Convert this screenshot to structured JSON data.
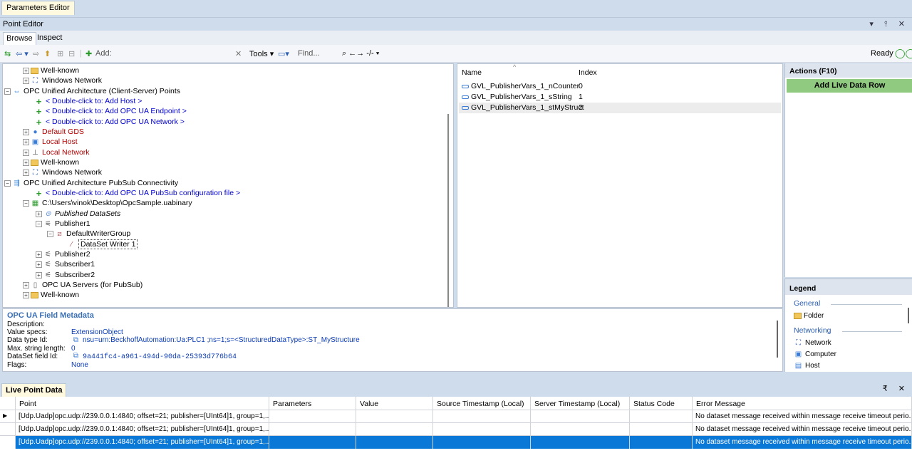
{
  "doc_tab": "Parameters Editor",
  "point_editor": {
    "title": "Point Editor",
    "controls": "▾ ⫯ ✕",
    "tabs": [
      "Browse",
      "Inspect"
    ]
  },
  "toolbar": {
    "add_label": "Add:",
    "tools_label": "Tools",
    "find_placeholder": "Find...",
    "nav_label": "←→ -/-",
    "status": "Ready"
  },
  "tree": [
    {
      "label": "Well-known",
      "style": "normal",
      "icon": "folder-icon"
    },
    {
      "label": "Windows Network",
      "style": "normal",
      "icon": "network-icon"
    },
    {
      "label": "OPC Unified Architecture (Client-Server) Points",
      "style": "normal",
      "icon": "opc-ua-icon"
    },
    {
      "label": "< Double-click to: Add Host >",
      "style": "blue",
      "icon": "add-icon"
    },
    {
      "label": "< Double-click to: Add OPC UA Endpoint >",
      "style": "blue",
      "icon": "add-icon"
    },
    {
      "label": "< Double-click to: Add OPC UA Network >",
      "style": "blue",
      "icon": "add-icon"
    },
    {
      "label": "Default GDS",
      "style": "red",
      "icon": "gds-icon"
    },
    {
      "label": "Local Host",
      "style": "red",
      "icon": "computer-icon"
    },
    {
      "label": "Local Network",
      "style": "red",
      "icon": "local-network-icon"
    },
    {
      "label": "Well-known",
      "style": "normal",
      "icon": "folder-icon"
    },
    {
      "label": "Windows Network",
      "style": "normal",
      "icon": "network-icon"
    },
    {
      "label": "OPC Unified Architecture PubSub Connectivity",
      "style": "normal",
      "icon": "pubsub-icon"
    },
    {
      "label": "< Double-click to: Add OPC UA PubSub configuration file >",
      "style": "blue",
      "icon": "add-icon"
    },
    {
      "label": "C:\\Users\\vinok\\Desktop\\OpcSample.uabinary",
      "style": "normal",
      "icon": "config-file-icon"
    },
    {
      "label": "Published DataSets",
      "style": "italic",
      "icon": "datasets-icon"
    },
    {
      "label": "Publisher1",
      "style": "normal",
      "icon": "publisher-icon"
    },
    {
      "label": "DefaultWriterGroup",
      "style": "normal",
      "icon": "writer-group-icon"
    },
    {
      "label": "DataSet Writer 1",
      "style": "selected",
      "icon": "dataset-writer-icon"
    },
    {
      "label": "Publisher2",
      "style": "normal",
      "icon": "publisher-icon"
    },
    {
      "label": "Subscriber1",
      "style": "normal",
      "icon": "subscriber-icon"
    },
    {
      "label": "Subscriber2",
      "style": "normal",
      "icon": "subscriber-icon"
    },
    {
      "label": "OPC UA Servers (for PubSub)",
      "style": "normal",
      "icon": "folder-icon"
    },
    {
      "label": "Well-known",
      "style": "normal",
      "icon": "folder-icon"
    }
  ],
  "list": {
    "col_name": "Name",
    "col_index": "Index",
    "rows": [
      {
        "name": "GVL_PublisherVars_1_nCounter",
        "index": "0"
      },
      {
        "name": "GVL_PublisherVars_1_sString",
        "index": "1"
      },
      {
        "name": "GVL_PublisherVars_1_stMyStruct",
        "index": "2"
      }
    ]
  },
  "actions": {
    "title": "Actions (F10)",
    "add_live": "Add Live Data Row"
  },
  "legend": {
    "title": "Legend",
    "general": "General",
    "folder": "Folder",
    "networking": "Networking",
    "network": "Network",
    "computer": "Computer",
    "host": "Host"
  },
  "metadata": {
    "title": "OPC UA Field Metadata",
    "description_label": "Description:",
    "value_specs_label": "Value specs:",
    "value_specs": "ExtensionObject",
    "data_type_label": "Data type Id:",
    "data_type": "nsu=urn:BeckhoffAutomation:Ua:PLC1 ;ns=1;s=<StructuredDataType>:ST_MyStructure",
    "max_len_label": "Max. string length:",
    "max_len": "0",
    "field_id_label": "DataSet field Id:",
    "field_id": "9a441fc4-a961-494d-90da-25393d776b64",
    "flags_label": "Flags:",
    "flags": "None"
  },
  "live": {
    "tab": "Live Point Data",
    "controls": "₹ ✕",
    "columns": [
      "Point",
      "Parameters",
      "Value",
      "Source Timestamp (Local)",
      "Server Timestamp (Local)",
      "Status Code",
      "Error Message"
    ],
    "rows": [
      {
        "point": "[Udp.Uadp]opc.udp://239.0.0.1:4840; offset=21; publisher=[UInt64]1, group=1,...",
        "error": "No dataset message received within message receive timeout perio..."
      },
      {
        "point": "[Udp.Uadp]opc.udp://239.0.0.1:4840; offset=21; publisher=[UInt64]1, group=1,...",
        "error": "No dataset message received within message receive timeout perio..."
      },
      {
        "point": "[Udp.Uadp]opc.udp://239.0.0.1:4840; offset=21; publisher=[UInt64]1, group=1,...",
        "error": "No dataset message received within message receive timeout perio..."
      }
    ]
  },
  "colors": {
    "accent": "#0a78d7",
    "action_green": "#8fca80",
    "link_blue": "#0000d0",
    "warn_red": "#b00000"
  }
}
